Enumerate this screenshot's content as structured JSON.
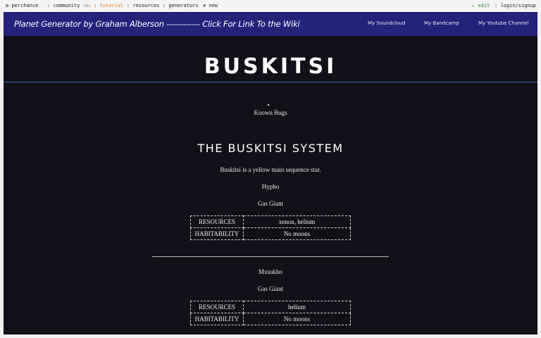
{
  "topbar": {
    "perchance": "perchance",
    "community": "community",
    "community_count": "(4h)",
    "tutorial": "tutorial",
    "resources": "resources",
    "generators": "generators",
    "new": "new",
    "edit": "edit",
    "login": "login/signup",
    "colors": {
      "tutorial": "#e07a1a",
      "edit": "#2e8b2e"
    }
  },
  "navbar": {
    "title": "Planet Generator by Graham Alberson ------------ Click For Link To the Wiki",
    "links": [
      "My Soundcloud",
      "My Bandcamp",
      "My Youtube Channel"
    ],
    "color": "#23237a"
  },
  "page": {
    "heading": "BUSKITSI",
    "known_bugs": "Known Bugs",
    "system_title": "THE BUSKITSI SYSTEM",
    "star_desc": "Buskitsi is a yellow main sequence star."
  },
  "planets": [
    {
      "name": "Hypho",
      "type": "Gas Giant",
      "resources_label": "RESOURCES",
      "resources": "xenon, helium",
      "habitability_label": "HABITABILITY",
      "habitability": "No moons"
    },
    {
      "name": "Mxsukho",
      "type": "Gas Giant",
      "resources_label": "RESOURCES",
      "resources": "helium",
      "habitability_label": "HABITABILITY",
      "habitability": "No moons"
    }
  ]
}
